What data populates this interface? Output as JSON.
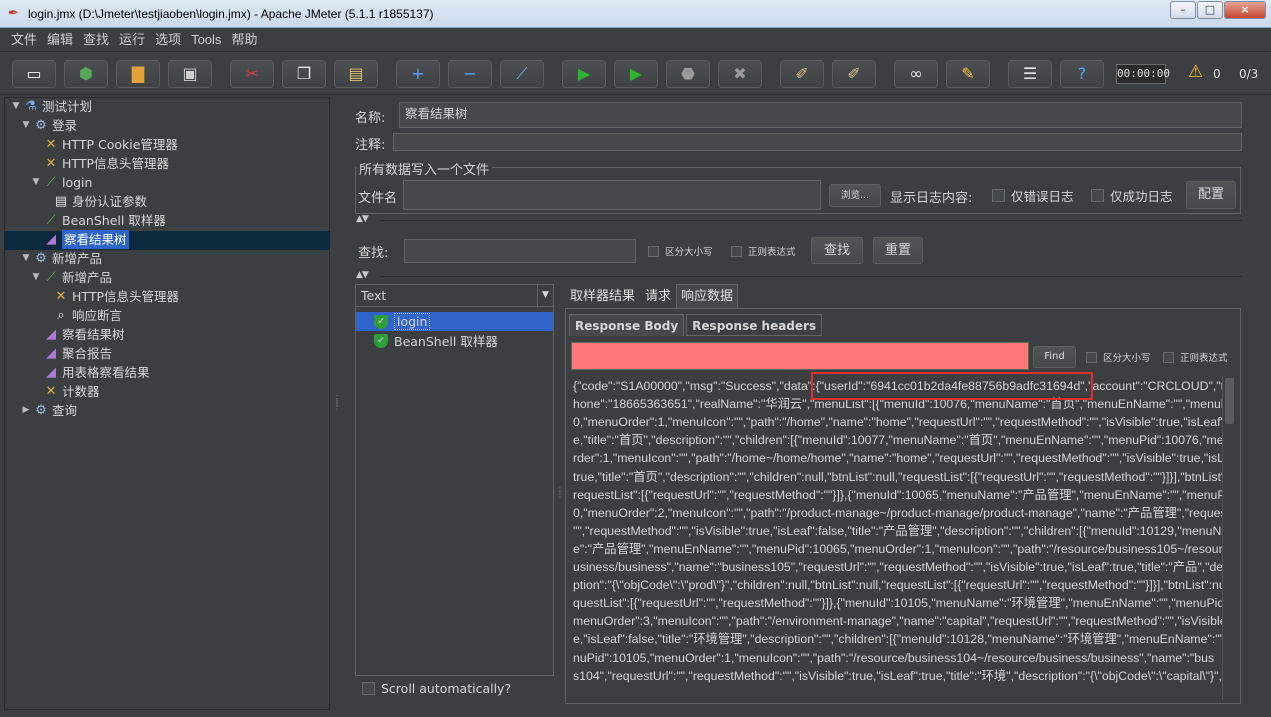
{
  "window": {
    "title": "login.jmx (D:\\Jmeter\\testjiaoben\\login.jmx) - Apache JMeter (5.1.1 r1855137)",
    "controls": [
      "–",
      "□",
      "×"
    ]
  },
  "menu": [
    "文件",
    "编辑",
    "查找",
    "运行",
    "选项",
    "Tools",
    "帮助"
  ],
  "toolbar": {
    "buttons": [
      {
        "name": "new-icon",
        "glyph": "▭",
        "color": "#f4f4f4"
      },
      {
        "name": "templates-icon",
        "glyph": "⬢",
        "color": "#58a65a"
      },
      {
        "name": "open-icon",
        "glyph": "▇",
        "color": "#e4a13a"
      },
      {
        "name": "save-icon",
        "glyph": "▣",
        "color": "#cfcfcf"
      },
      {
        "name": "cut-icon",
        "glyph": "✂",
        "color": "#e04040"
      },
      {
        "name": "copy-icon",
        "glyph": "❐",
        "color": "#e6e6e6"
      },
      {
        "name": "paste-icon",
        "glyph": "▤",
        "color": "#e0c070"
      },
      {
        "name": "expand-icon",
        "glyph": "+",
        "color": "#5aa0ff"
      },
      {
        "name": "collapse-icon",
        "glyph": "−",
        "color": "#5aa0ff"
      },
      {
        "name": "toggle-icon",
        "glyph": "⟋",
        "color": "#7ab0e0"
      },
      {
        "name": "start-icon",
        "glyph": "▶",
        "color": "#2fb02f"
      },
      {
        "name": "start-no-pause-icon",
        "glyph": "▶",
        "color": "#2fb02f"
      },
      {
        "name": "stop-icon",
        "glyph": "⬣",
        "color": "#9a9a9a"
      },
      {
        "name": "shutdown-icon",
        "glyph": "✖",
        "color": "#9a9a9a"
      },
      {
        "name": "clear-icon",
        "glyph": "✐",
        "color": "#d8c08a"
      },
      {
        "name": "clear-all-icon",
        "glyph": "✐",
        "color": "#d8c08a"
      },
      {
        "name": "search-icon",
        "glyph": "∞",
        "color": "#e6e6e6"
      },
      {
        "name": "reset-search-icon",
        "glyph": "✎",
        "color": "#f2c230"
      },
      {
        "name": "function-helper-icon",
        "glyph": "☰",
        "color": "#e6e6e6"
      },
      {
        "name": "help-icon",
        "glyph": "?",
        "color": "#5aa0ff"
      }
    ],
    "timer": "00:00:00",
    "warnings": "0",
    "threads": "0/3"
  },
  "tree": [
    {
      "label": "测试计划",
      "indent": 0,
      "arrow": "▼",
      "icon": "flask-icon",
      "glyph": "⚗",
      "color": "#7fa7e6"
    },
    {
      "label": "登录",
      "indent": 1,
      "arrow": "▼",
      "icon": "gear-icon",
      "glyph": "⚙",
      "color": "#9ab7de"
    },
    {
      "label": "HTTP Cookie管理器",
      "indent": 2,
      "arrow": "",
      "icon": "wrench-icon",
      "glyph": "✕",
      "color": "#e0b040"
    },
    {
      "label": "HTTP信息头管理器",
      "indent": 2,
      "arrow": "",
      "icon": "wrench-icon",
      "glyph": "✕",
      "color": "#e0b040"
    },
    {
      "label": "login",
      "indent": 2,
      "arrow": "▼",
      "icon": "pipette-icon",
      "glyph": "⟋",
      "color": "#5cbf5c"
    },
    {
      "label": "身份认证参数",
      "indent": 3,
      "arrow": "",
      "icon": "document-icon",
      "glyph": "▤",
      "color": "#e6e6e6"
    },
    {
      "label": "BeanShell 取样器",
      "indent": 2,
      "arrow": "",
      "icon": "pipette-icon",
      "glyph": "⟋",
      "color": "#5cbf5c"
    },
    {
      "label": "察看结果树",
      "indent": 2,
      "arrow": "",
      "icon": "chart-icon",
      "glyph": "◢",
      "color": "#b07ad6",
      "selected": true
    },
    {
      "label": "新增产品",
      "indent": 1,
      "arrow": "▼",
      "icon": "gear-icon",
      "glyph": "⚙",
      "color": "#9ab7de"
    },
    {
      "label": "新增产品",
      "indent": 2,
      "arrow": "▼",
      "icon": "pipette-icon",
      "glyph": "⟋",
      "color": "#5cbf5c"
    },
    {
      "label": "HTTP信息头管理器",
      "indent": 3,
      "arrow": "",
      "icon": "wrench-icon",
      "glyph": "✕",
      "color": "#e0b040"
    },
    {
      "label": "响应断言",
      "indent": 3,
      "arrow": "",
      "icon": "magnifier-icon",
      "glyph": "⌕",
      "color": "#e6e6e6"
    },
    {
      "label": "察看结果树",
      "indent": 2,
      "arrow": "",
      "icon": "chart-icon",
      "glyph": "◢",
      "color": "#b07ad6"
    },
    {
      "label": "聚合报告",
      "indent": 2,
      "arrow": "",
      "icon": "chart-icon",
      "glyph": "◢",
      "color": "#b07ad6"
    },
    {
      "label": "用表格察看结果",
      "indent": 2,
      "arrow": "",
      "icon": "chart-icon",
      "glyph": "◢",
      "color": "#b07ad6"
    },
    {
      "label": "计数器",
      "indent": 2,
      "arrow": "",
      "icon": "wrench-icon",
      "glyph": "✕",
      "color": "#e0b040"
    },
    {
      "label": "查询",
      "indent": 1,
      "arrow": "▶",
      "icon": "gear-icon",
      "glyph": "⚙",
      "color": "#9ab7de"
    }
  ],
  "panel": {
    "name_label": "名称:",
    "name_value": "察看结果树",
    "comment_label": "注释:",
    "comment_value": "",
    "file_group_title": "所有数据写入一个文件",
    "filename_label": "文件名",
    "filename_value": "",
    "browse_label": "浏览...",
    "log_content_label": "显示日志内容:",
    "errors_only_label": "仅错误日志",
    "success_only_label": "仅成功日志",
    "configure_label": "配置",
    "search_label": "查找:",
    "search_value": "",
    "case_sensitive_label": "区分大小写",
    "regex_label": "正则表达式",
    "search_button": "查找",
    "reset_button": "重置",
    "renderer": "Text",
    "scroll_auto_label": "Scroll automatically?"
  },
  "results": [
    {
      "label": "login",
      "status": "success",
      "selected": true
    },
    {
      "label": "BeanShell 取样器",
      "status": "success",
      "selected": false
    }
  ],
  "result_tabs": [
    "取样器结果",
    "请求",
    "响应数据"
  ],
  "active_result_tab": "响应数据",
  "response_tabs": [
    "Response Body",
    "Response headers"
  ],
  "active_response_tab": "Response Body",
  "find": {
    "value": "",
    "button": "Find",
    "case_label": "区分大小写",
    "regex_label": "正则表达式"
  },
  "response_lines": [
    "{\"code\":\"S1A00000\",\"msg\":\"Success\",\"data\":{\"userId\":\"6941cc01b2da4fe88756b9adfc31694d\",\"account\":\"CRCLOUD\",\"te",
    "hone\":\"18665363651\",\"realName\":\"华润云\",\"menuList\":[{\"menuId\":10076,\"menuName\":\"首页\",\"menuEnName\":\"\",\"menul",
    "0,\"menuOrder\":1,\"menuIcon\":\"\",\"path\":\"/home\",\"name\":\"home\",\"requestUrl\":\"\",\"requestMethod\":\"\",\"isVisible\":true,\"isLeaf\"",
    "e,\"title\":\"首页\",\"description\":\"\",\"children\":[{\"menuId\":10077,\"menuName\":\"首页\",\"menuEnName\":\"\",\"menuPid\":10076,\"mer",
    "rder\":1,\"menuIcon\":\"\",\"path\":\"/home~/home/home\",\"name\":\"home\",\"requestUrl\":\"\",\"requestMethod\":\"\",\"isVisible\":true,\"isLe",
    "true,\"title\":\"首页\",\"description\":\"\",\"children\":null,\"btnList\":null,\"requestList\":[{\"requestUrl\":\"\",\"requestMethod\":\"\"}]}],\"btnList\":r",
    "requestList\":[{\"requestUrl\":\"\",\"requestMethod\":\"\"}]},{\"menuId\":10065,\"menuName\":\"产品管理\",\"menuEnName\":\"\",\"menuP",
    "0,\"menuOrder\":2,\"menuIcon\":\"\",\"path\":\"/product-manage~/product-manage/product-manage\",\"name\":\"产品管理\",\"reques",
    "\"\",\"requestMethod\":\"\",\"isVisible\":true,\"isLeaf\":false,\"title\":\"产品管理\",\"description\":\"\",\"children\":[{\"menuId\":10129,\"menuN",
    "e\":\"产品管理\",\"menuEnName\":\"\",\"menuPid\":10065,\"menuOrder\":1,\"menuIcon\":\"\",\"path\":\"/resource/business105~/resour",
    "usiness/business\",\"name\":\"business105\",\"requestUrl\":\"\",\"requestMethod\":\"\",\"isVisible\":true,\"isLeaf\":true,\"title\":\"产品\",\"de",
    "ption\":\"{\\\"objCode\\\":\\\"prod\\\"}\",\"children\":null,\"btnList\":null,\"requestList\":[{\"requestUrl\":\"\",\"requestMethod\":\"\"}]}],\"btnList\":null",
    "questList\":[{\"requestUrl\":\"\",\"requestMethod\":\"\"}]},{\"menuId\":10105,\"menuName\":\"环境管理\",\"menuEnName\":\"\",\"menuPid\"",
    "menuOrder\":3,\"menuIcon\":\"\",\"path\":\"/environment-manage\",\"name\":\"capital\",\"requestUrl\":\"\",\"requestMethod\":\"\",\"isVisible",
    "e,\"isLeaf\":false,\"title\":\"环境管理\",\"description\":\"\",\"children\":[{\"menuId\":10128,\"menuName\":\"环境管理\",\"menuEnName\":\"\",",
    "nuPid\":10105,\"menuOrder\":1,\"menuIcon\":\"\",\"path\":\"/resource/business104~/resource/business/business\",\"name\":\"bus",
    "s104\",\"requestUrl\":\"\",\"requestMethod\":\"\",\"isVisible\":true,\"isLeaf\":true,\"title\":\"环境\",\"description\":\"{\\\"objCode\\\":\\\"capital\\\"}\",\"c"
  ]
}
